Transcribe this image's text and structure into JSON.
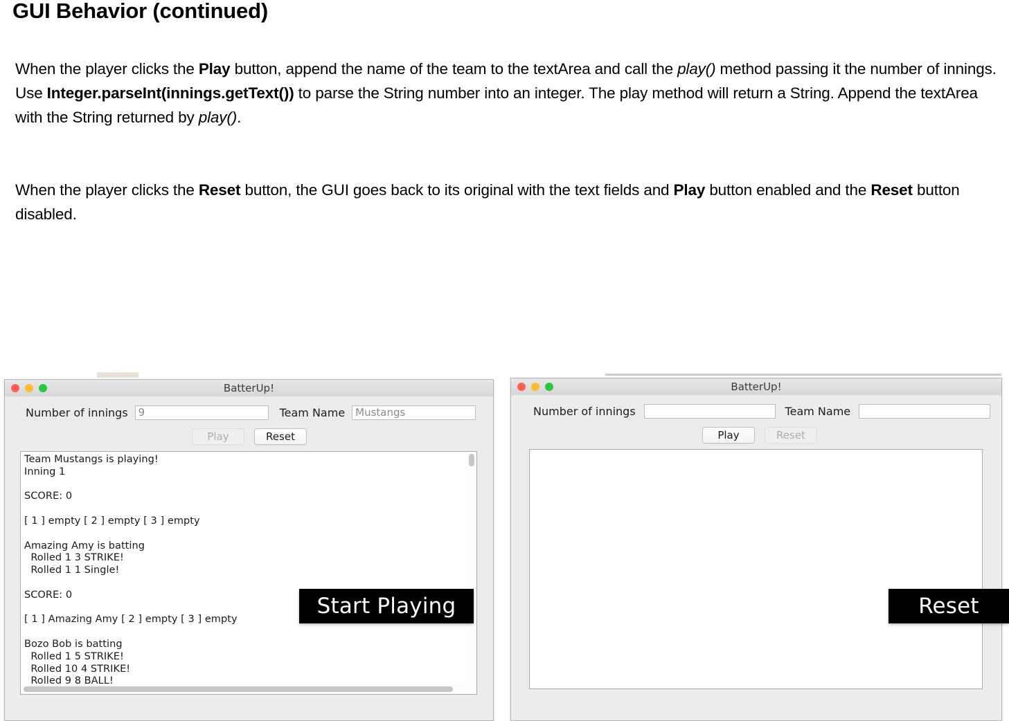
{
  "slide": {
    "title": "GUI Behavior (continued)",
    "paragraph_1_parts": [
      {
        "text": "When the player clicks the ",
        "style": "normal"
      },
      {
        "text": "Play",
        "style": "bold"
      },
      {
        "text": " button, append the name of the team to the textArea and call the ",
        "style": "normal"
      },
      {
        "text": "play()",
        "style": "italic"
      },
      {
        "text": " method passing it the number of innings. Use ",
        "style": "normal"
      },
      {
        "text": "Integer.parseInt(innings.getText())",
        "style": "bold"
      },
      {
        "text": " to parse the String number into an integer. The play method will return a String. Append the textArea with the String returned by ",
        "style": "normal"
      },
      {
        "text": "play()",
        "style": "italic"
      },
      {
        "text": ".",
        "style": "normal"
      }
    ],
    "paragraph_2_parts": [
      {
        "text": "When the player clicks the ",
        "style": "normal"
      },
      {
        "text": "Reset",
        "style": "bold"
      },
      {
        "text": " button, the GUI goes back to its original with the text fields and ",
        "style": "normal"
      },
      {
        "text": "Play",
        "style": "bold"
      },
      {
        "text": " button enabled and the ",
        "style": "normal"
      },
      {
        "text": "Reset",
        "style": "bold"
      },
      {
        "text": " button disabled.",
        "style": "normal"
      }
    ]
  },
  "left_window": {
    "title": "BatterUp!",
    "traffic_lights": [
      "close-button",
      "minimize-button",
      "zoom-button"
    ],
    "innings_label": "Number of innings",
    "innings_value": "9",
    "team_label": "Team Name",
    "team_value": "Mustangs",
    "play_button": "Play",
    "play_enabled": false,
    "reset_button": "Reset",
    "reset_enabled": true,
    "textarea_content": "Team Mustangs is playing!\nInning 1\n\nSCORE: 0\n\n[ 1 ] empty [ 2 ] empty [ 3 ] empty\n\nAmazing Amy is batting\n  Rolled 1 3 STRIKE!\n  Rolled 1 1 Single!\n\nSCORE: 0\n\n[ 1 ] Amazing Amy [ 2 ] empty [ 3 ] empty\n\nBozo Bob is batting\n  Rolled 1 5 STRIKE!\n  Rolled 10 4 STRIKE!\n  Rolled 9 8 BALL!",
    "callout": "Start Playing"
  },
  "right_window": {
    "title": "BatterUp!",
    "traffic_lights": [
      "close-button",
      "minimize-button",
      "zoom-button"
    ],
    "innings_label": "Number of innings",
    "innings_value": "",
    "team_label": "Team Name",
    "team_value": "",
    "play_button": "Play",
    "play_enabled": true,
    "reset_button": "Reset",
    "reset_enabled": false,
    "textarea_content": "",
    "callout": "Reset"
  },
  "colors": {
    "traffic_red": "#ff5f57",
    "traffic_yellow": "#febc2e",
    "traffic_green": "#28c840",
    "window_chrome": "#ececec",
    "callout_bg": "#000000",
    "callout_fg": "#ffffff"
  }
}
